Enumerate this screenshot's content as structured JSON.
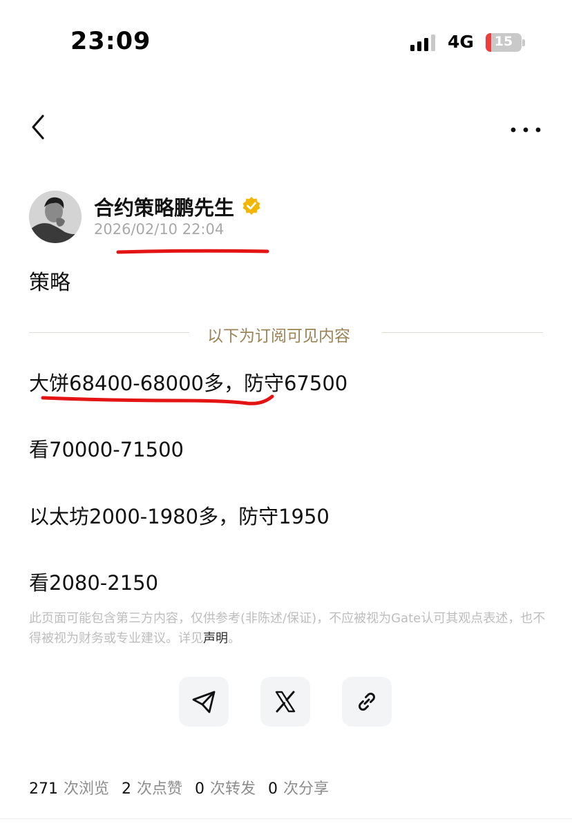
{
  "status_bar": {
    "time": "23:09",
    "network": "4G",
    "battery_percent": "15",
    "battery_level": 0.15
  },
  "nav": {
    "back_icon": "chevron-left-icon",
    "more_icon": "ellipsis-horizontal-icon"
  },
  "author": {
    "name": "合约策略鹏先生",
    "verified_icon": "verified-badge-icon",
    "date": "2026/02/10 22:04"
  },
  "post": {
    "title": "策略",
    "subscriber_divider": "以下为订阅可见内容",
    "lines": [
      "大饼68400-68000多，防守67500",
      "看70000-71500",
      "以太坊2000-1980多，防守1950",
      "看2080-2150"
    ]
  },
  "disclaimer": {
    "text": "此页面可能包含第三方内容，仅供参考(非陈述/保证)，不应被视为Gate认可其观点表述，也不得被视为财务或专业建议。详见",
    "link": "声明",
    "tail": "。"
  },
  "share": [
    {
      "icon": "telegram-icon"
    },
    {
      "icon": "x-icon"
    },
    {
      "icon": "link-icon"
    }
  ],
  "stats": {
    "views": "271",
    "views_label": "次浏览",
    "likes": "2",
    "likes_label": "次点赞",
    "reposts": "0",
    "reposts_label": "次转发",
    "shares": "0",
    "shares_label": "次分享"
  },
  "colors": {
    "divider_text": "#9b8355",
    "verified": "#f2b705",
    "annotation_red": "#e41414",
    "muted": "#a8a8a8"
  }
}
